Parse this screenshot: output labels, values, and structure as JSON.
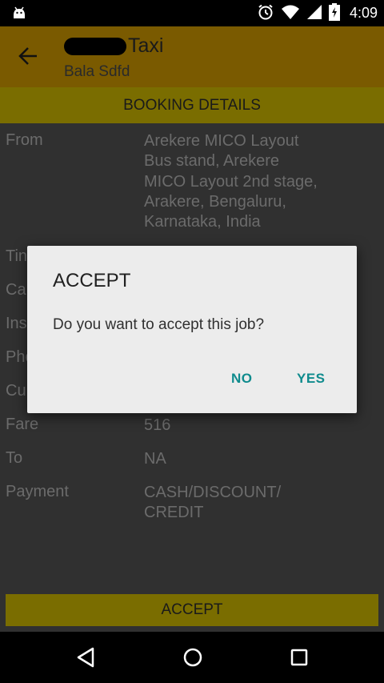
{
  "status_bar": {
    "time": "4:09",
    "icons": [
      "android-icon",
      "alarm-icon",
      "wifi-icon",
      "cellular-signal-icon",
      "battery-charging-icon"
    ]
  },
  "app_bar": {
    "title": "Taxi",
    "subtitle": "Bala Sdfd",
    "color": "#7a5a00"
  },
  "section_header": "BOOKING DETAILS",
  "details": [
    {
      "label": "From",
      "value": "Arekere MICO Layout\nBus stand, Arekere\nMICO Layout 2nd stage,\nArakere, Bengaluru,\nKarnataka, India"
    },
    {
      "label": "Tin",
      "value": ""
    },
    {
      "label": "Ca",
      "value": ""
    },
    {
      "label": "Ins",
      "value": ""
    },
    {
      "label": "Pho",
      "value": ""
    },
    {
      "label": "Cu",
      "value": ""
    },
    {
      "label": "Fare",
      "value": "516"
    },
    {
      "label": "To",
      "value": "NA"
    },
    {
      "label": "Payment",
      "value": "CASH/DISCOUNT/\nCREDIT"
    }
  ],
  "accept_button": "ACCEPT",
  "dialog": {
    "title": "ACCEPT",
    "message": "Do you want to accept this job?",
    "no_label": "NO",
    "yes_label": "YES",
    "button_color": "#0f8b8d"
  },
  "nav_bar": {
    "icons": [
      "back-triangle-icon",
      "home-circle-icon",
      "recents-square-icon"
    ]
  }
}
